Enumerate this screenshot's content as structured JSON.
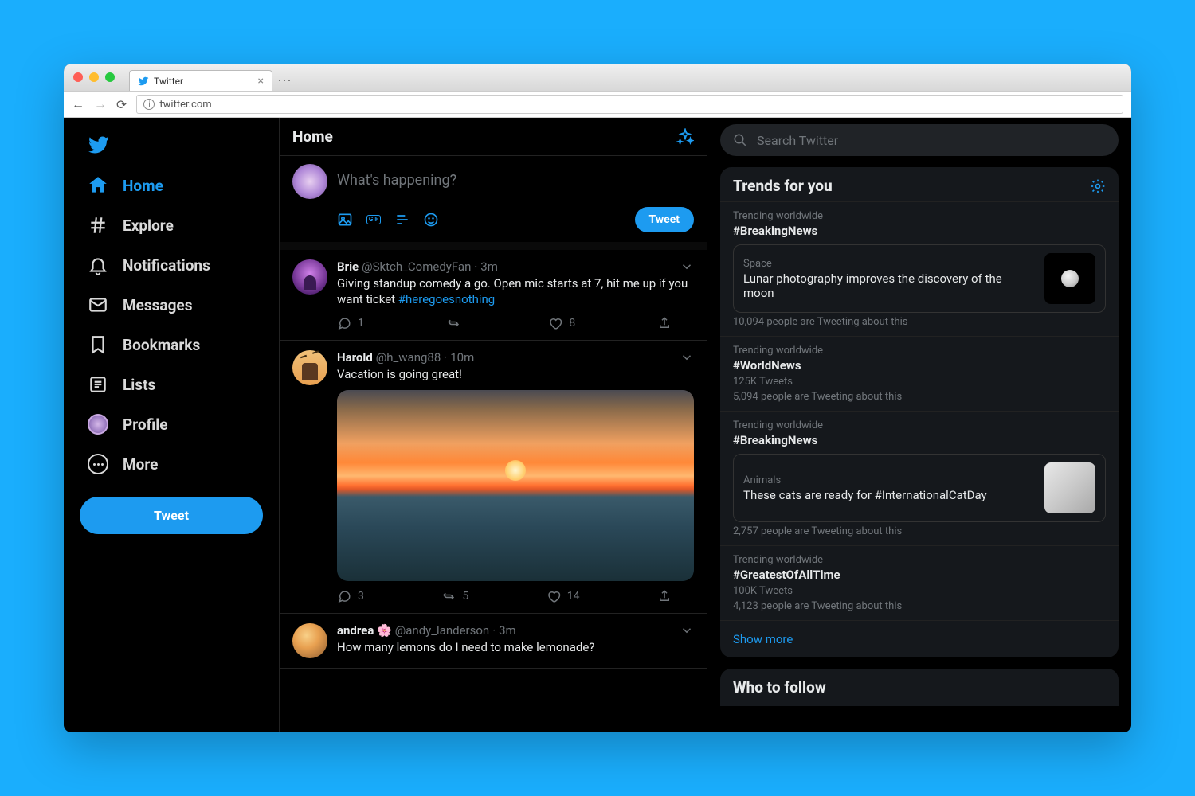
{
  "browser": {
    "tab_title": "Twitter",
    "url": "twitter.com"
  },
  "sidebar": {
    "items": [
      {
        "label": "Home"
      },
      {
        "label": "Explore"
      },
      {
        "label": "Notifications"
      },
      {
        "label": "Messages"
      },
      {
        "label": "Bookmarks"
      },
      {
        "label": "Lists"
      },
      {
        "label": "Profile"
      },
      {
        "label": "More"
      }
    ],
    "tweet_button": "Tweet"
  },
  "main": {
    "header": "Home",
    "compose": {
      "placeholder": "What's happening?",
      "tweet_label": "Tweet"
    },
    "tweets": [
      {
        "name": "Brie",
        "handle": "@Sktch_ComedyFan",
        "time": "3m",
        "text": "Giving standup comedy a go. Open mic starts at 7, hit me up if you want ticket ",
        "hashtag": "#heregoesnothing",
        "replies": "1",
        "retweets": "",
        "likes": "8"
      },
      {
        "name": "Harold",
        "handle": "@h_wang88",
        "time": "10m",
        "text": "Vacation is going great!",
        "hashtag": "",
        "replies": "3",
        "retweets": "5",
        "likes": "14"
      },
      {
        "name": "andrea 🌸",
        "handle": "@andy_landerson",
        "time": "3m",
        "text": "How many lemons do I need to make lemonade?",
        "hashtag": "",
        "replies": "",
        "retweets": "",
        "likes": ""
      }
    ]
  },
  "right": {
    "search_placeholder": "Search Twitter",
    "trends_header": "Trends for you",
    "show_more": "Show more",
    "who_header": "Who to follow",
    "trends": [
      {
        "context": "Trending worldwide",
        "topic": "#BreakingNews",
        "card": {
          "category": "Space",
          "headline": "Lunar photography improves the discovery of the moon"
        },
        "sub": "10,094 people are Tweeting about this"
      },
      {
        "context": "Trending worldwide",
        "topic": "#WorldNews",
        "sub1": "125K Tweets",
        "sub": "5,094 people are Tweeting about this"
      },
      {
        "context": "Trending worldwide",
        "topic": "#BreakingNews",
        "card": {
          "category": "Animals",
          "headline": "These cats are ready for #InternationalCatDay"
        },
        "sub": "2,757 people are Tweeting about this"
      },
      {
        "context": "Trending worldwide",
        "topic": "#GreatestOfAllTime",
        "sub1": "100K Tweets",
        "sub": "4,123 people are Tweeting about this"
      }
    ]
  }
}
